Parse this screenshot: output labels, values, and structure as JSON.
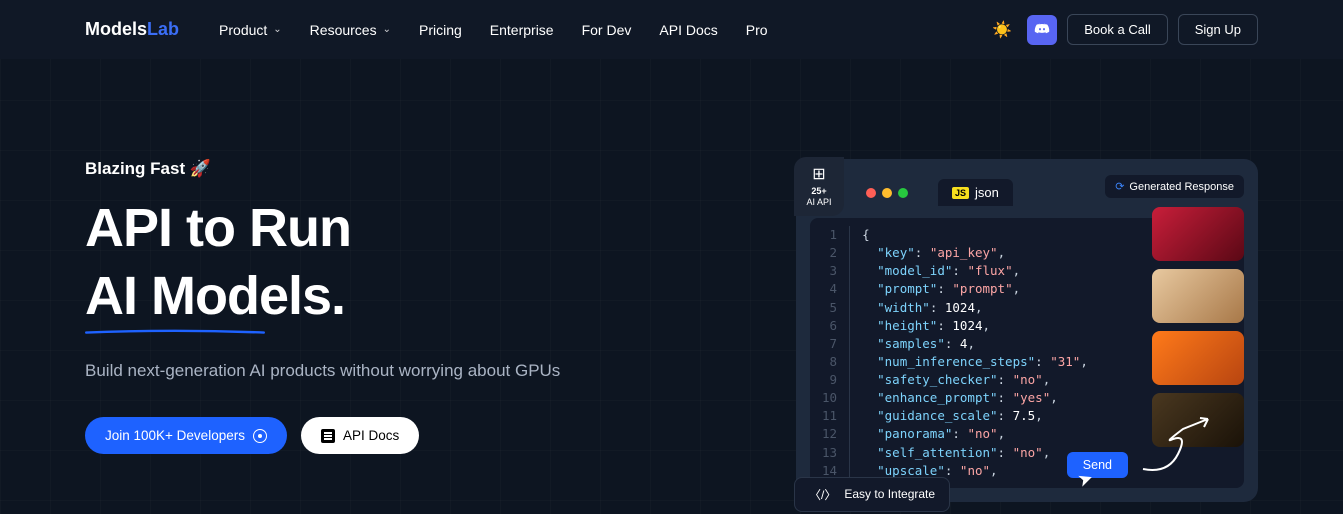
{
  "nav": {
    "logo_a": "Models",
    "logo_b": "Lab",
    "items": [
      "Product",
      "Resources",
      "Pricing",
      "Enterprise",
      "For Dev",
      "API Docs",
      "Pro"
    ],
    "book": "Book a Call",
    "signup": "Sign Up"
  },
  "hero": {
    "blazing": "Blazing Fast 🚀",
    "h1a": "API to Run",
    "h1b": "AI Models.",
    "sub": "Build next-generation AI products without worrying about GPUs",
    "cta1": "Join 100K+ Developers",
    "cta2": "API Docs"
  },
  "panel": {
    "api_count": "25+",
    "api_label": "AI API",
    "tab": "json",
    "tab_lang": "JS",
    "gen": "Generated Response",
    "send": "Send",
    "easy": "Easy to Integrate",
    "code": {
      "lines": [
        {
          "n": 1,
          "raw": "{"
        },
        {
          "n": 2,
          "key": "key",
          "val": "api_key",
          "t": "s",
          "comma": true
        },
        {
          "n": 3,
          "key": "model_id",
          "val": "flux",
          "t": "s",
          "comma": true
        },
        {
          "n": 4,
          "key": "prompt",
          "val": "prompt",
          "t": "s",
          "comma": true
        },
        {
          "n": 5,
          "key": "width",
          "val": "1024",
          "t": "w",
          "comma": true
        },
        {
          "n": 6,
          "key": "height",
          "val": "1024",
          "t": "w",
          "comma": true
        },
        {
          "n": 7,
          "key": "samples",
          "val": "4",
          "t": "w",
          "comma": true
        },
        {
          "n": 8,
          "key": "num_inference_steps",
          "val": "31",
          "t": "s",
          "comma": true
        },
        {
          "n": 9,
          "key": "safety_checker",
          "val": "no",
          "t": "s",
          "comma": true
        },
        {
          "n": 10,
          "key": "enhance_prompt",
          "val": "yes",
          "t": "s",
          "comma": true
        },
        {
          "n": 11,
          "key": "guidance_scale",
          "val": "7.5",
          "t": "w",
          "comma": true
        },
        {
          "n": 12,
          "key": "panorama",
          "val": "no",
          "t": "s",
          "comma": true
        },
        {
          "n": 13,
          "key": "self_attention",
          "val": "no",
          "t": "s",
          "comma": true
        },
        {
          "n": 14,
          "key": "upscale",
          "val": "no",
          "t": "s",
          "comma": true
        }
      ]
    }
  }
}
